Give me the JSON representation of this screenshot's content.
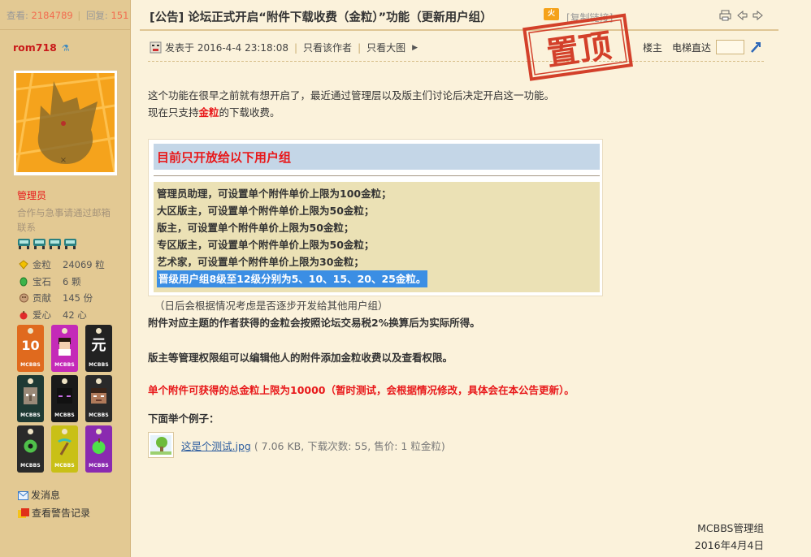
{
  "stats": {
    "views_label": "查看:",
    "views": "2184789",
    "replies_label": "回复:",
    "replies": "151"
  },
  "user": {
    "name": "rom718",
    "group": "管理员",
    "contact": "合作与急事请通过邮箱联系",
    "stats": [
      {
        "icon": "gold-coin-icon",
        "label": "金粒",
        "value": "24069 粒"
      },
      {
        "icon": "gem-icon",
        "label": "宝石",
        "value": "6 颗"
      },
      {
        "icon": "contribution-icon",
        "label": "贡献",
        "value": "145 份"
      },
      {
        "icon": "heart-icon",
        "label": "爱心",
        "value": "42 心"
      }
    ],
    "medal_tag": "MCBBS",
    "medal_1": "10",
    "medal_3": "元",
    "links": {
      "message": "发消息",
      "warnings": "查看警告记录"
    }
  },
  "post": {
    "title": "[公告] 论坛正式开启“附件下载收费（金粒）”功能（更新用户组）",
    "hot": "火",
    "copy_link": "[复制链接]",
    "posted_at": "发表于 2016-4-4 23:18:08",
    "only_author": "只看该作者",
    "big_image": "只看大图",
    "floor": "楼主",
    "elevator": "电梯直达",
    "stamp": "置顶",
    "intro_1": "这个功能在很早之前就有想开启了，最近通过管理层以及版主们讨论后决定开启这一功能。",
    "intro_2_pre": "现在只支持",
    "intro_2_gold": "金粒",
    "intro_2_post": "的下载收费。",
    "group_title": "目前只开放给以下用户组",
    "groups": [
      "管理员助理，可设置单个附件单价上限为100金粒；",
      "大区版主，可设置单个附件单价上限为50金粒；",
      "版主，可设置单个附件单价上限为50金粒；",
      "专区版主，可设置单个附件单价上限为50金粒；",
      "艺术家，可设置单个附件单价上限为30金粒；",
      "晋级用户组8级至12级分别为5、10、15、20、25金粒。"
    ],
    "note": "（日后会根据情况考虑是否逐步开发给其他用户组）",
    "tax": "附件对应主题的作者获得的金粒会按照论坛交易税2%换算后为实际所得。",
    "mods": "版主等管理权限组可以编辑他人的附件添加金粒收费以及查看权限。",
    "limit": "单个附件可获得的总金粒上限为10000（暂时测试，会根据情况修改，具体会在本公告更新）。",
    "example": "下面举个例子：",
    "attachment_name": "这是个测试.jpg",
    "attachment_info": "( 7.06 KB, 下载次数: 55, 售价: 1 粒金粒)",
    "sig_1": "MCBBS管理组",
    "sig_2": "2016年4月4日"
  }
}
